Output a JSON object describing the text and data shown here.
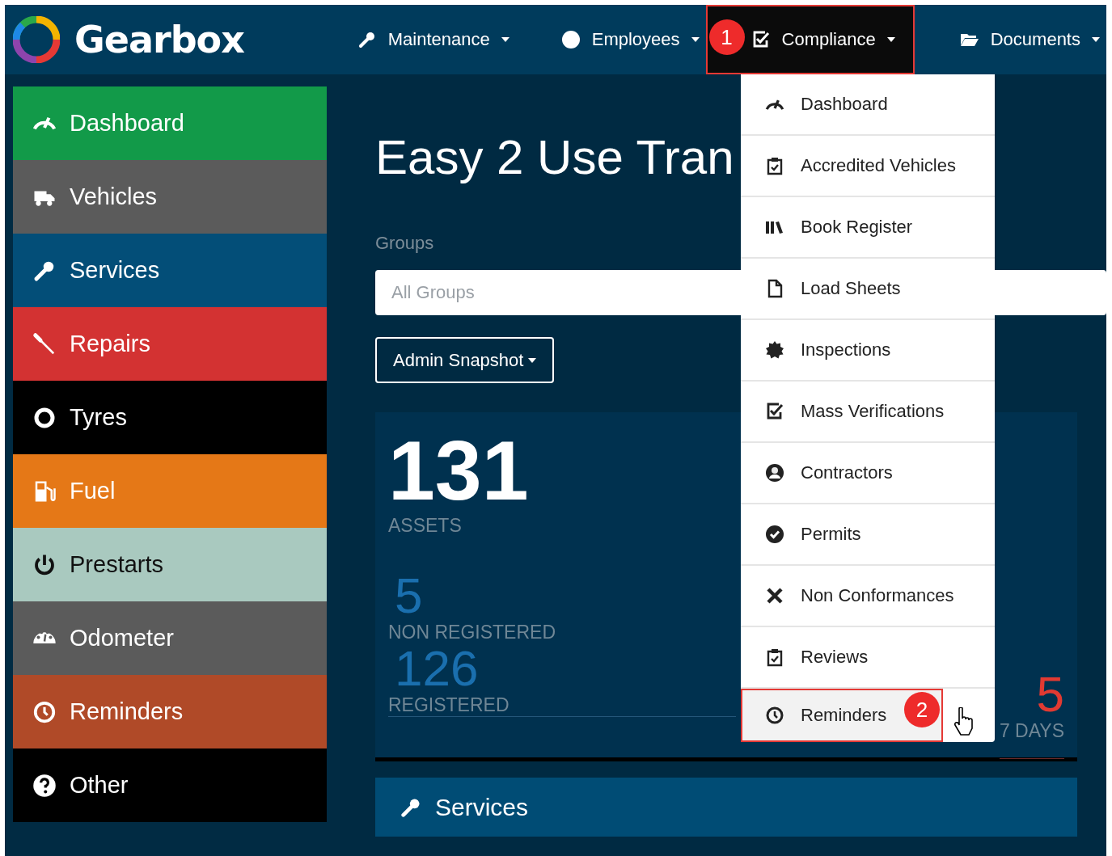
{
  "brand": {
    "name": "Gearbox"
  },
  "nav": [
    {
      "label": "Maintenance",
      "selected": false
    },
    {
      "label": "Employees",
      "selected": false
    },
    {
      "label": "Compliance",
      "selected": true,
      "marker": "1"
    },
    {
      "label": "Documents",
      "selected": false
    }
  ],
  "sidebar": {
    "items": [
      {
        "label": "Dashboard",
        "color": "#129a49"
      },
      {
        "label": "Vehicles",
        "color": "#5b5b5b"
      },
      {
        "label": "Services",
        "color": "#034e78"
      },
      {
        "label": "Repairs",
        "color": "#d33232"
      },
      {
        "label": "Tyres",
        "color": "#000000"
      },
      {
        "label": "Fuel",
        "color": "#e57817"
      },
      {
        "label": "Prestarts",
        "color": "#a9c9bf"
      },
      {
        "label": "Odometer",
        "color": "#5b5b5b"
      },
      {
        "label": "Reminders",
        "color": "#b04a28"
      },
      {
        "label": "Other",
        "color": "#000000"
      }
    ]
  },
  "page": {
    "title": "Easy 2 Use Tran",
    "groups_label": "Groups",
    "groups_field": {
      "placeholder": "All Groups"
    },
    "snapshot_button": "Admin Snapshot"
  },
  "card": {
    "total": "131",
    "total_label": "ASSETS",
    "stats": [
      {
        "value": "5",
        "label": "NON REGISTERED"
      },
      {
        "value": "126",
        "label": "REGISTERED"
      }
    ],
    "side_value": "5",
    "side_label": "7 DAYS"
  },
  "services_panel": {
    "title": "Services"
  },
  "dropdown": {
    "items": [
      {
        "label": "Dashboard",
        "selected": false
      },
      {
        "label": "Accredited Vehicles",
        "selected": false
      },
      {
        "label": "Book Register",
        "selected": false
      },
      {
        "label": "Load Sheets",
        "selected": false
      },
      {
        "label": "Inspections",
        "selected": false
      },
      {
        "label": "Mass Verifications",
        "selected": false
      },
      {
        "label": "Contractors",
        "selected": false
      },
      {
        "label": "Permits",
        "selected": false
      },
      {
        "label": "Non Conformances",
        "selected": false
      },
      {
        "label": "Reviews",
        "selected": false
      },
      {
        "label": "Reminders",
        "selected": true,
        "marker": "2"
      }
    ]
  }
}
